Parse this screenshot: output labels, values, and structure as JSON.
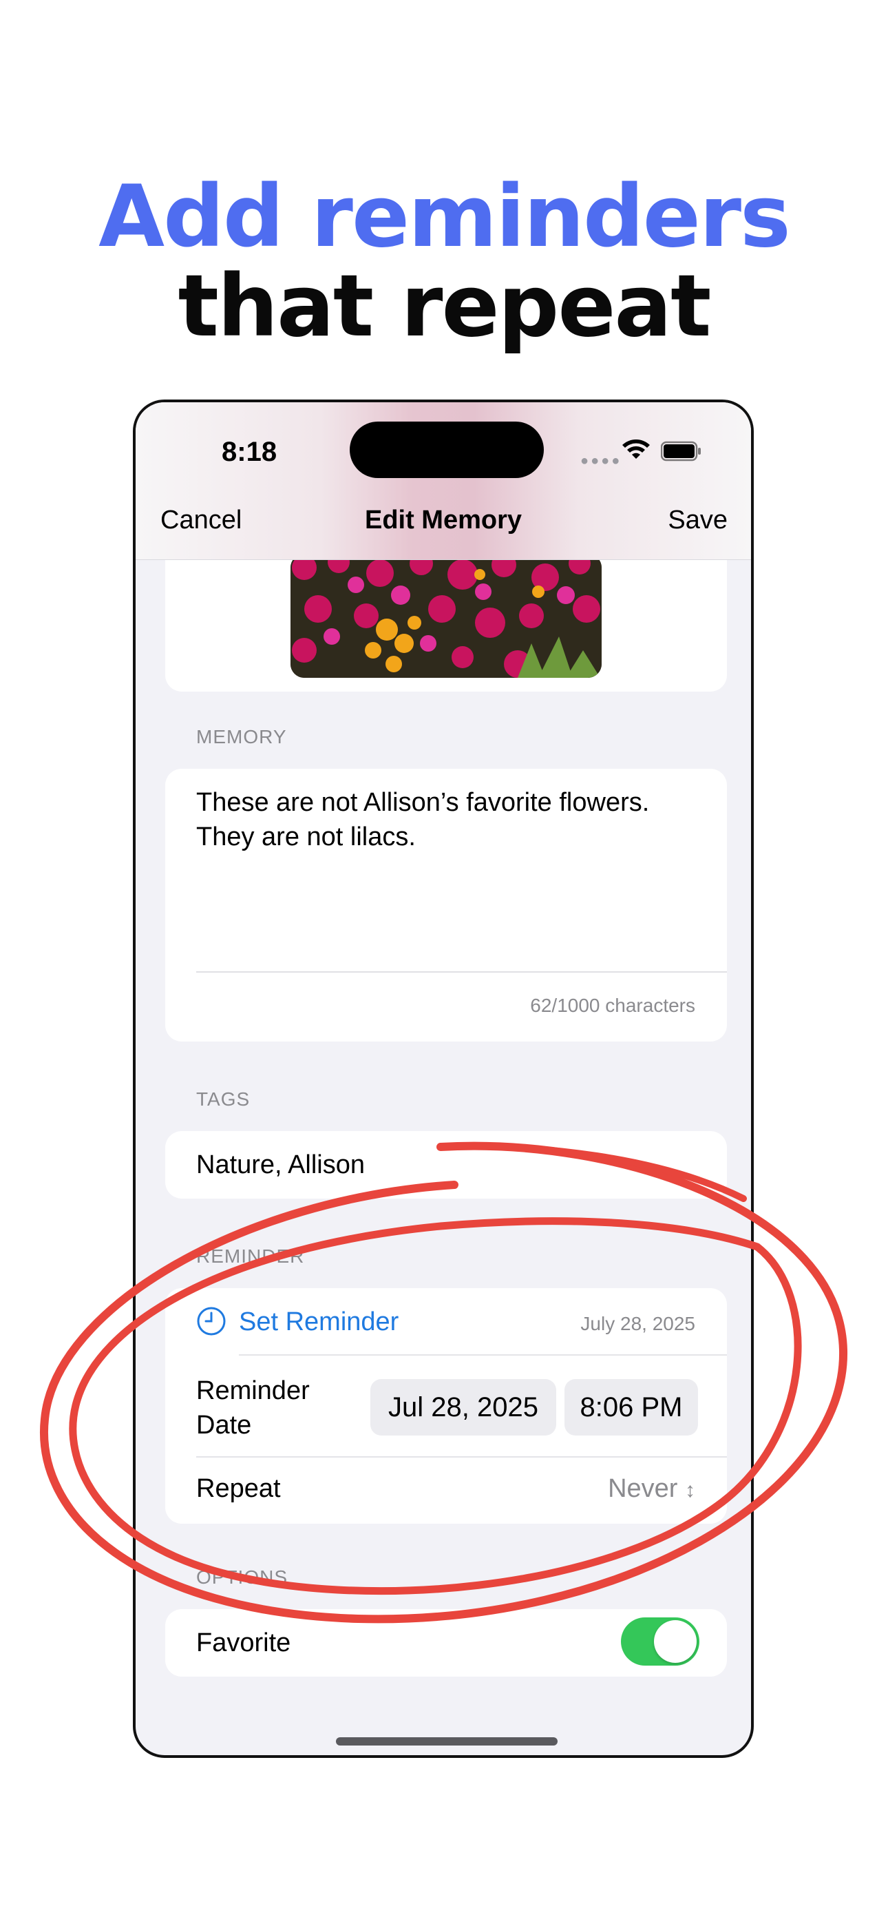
{
  "headline": {
    "line1": "Add reminders",
    "line2": "that repeat"
  },
  "status_bar": {
    "time": "8:18"
  },
  "nav": {
    "cancel": "Cancel",
    "title": "Edit Memory",
    "save": "Save"
  },
  "memory": {
    "label": "MEMORY",
    "text_line1": "These are not Allison’s favorite flowers.",
    "text_line2": "They are not lilacs.",
    "char_count": "62/1000 characters"
  },
  "tags": {
    "label": "TAGS",
    "value": "Nature, Allison"
  },
  "reminder": {
    "label": "REMINDER",
    "set_label": "Set Reminder",
    "date_summary": "July 28, 2025",
    "date_label_line1": "Reminder",
    "date_label_line2": "Date",
    "date_value": "Jul 28, 2025",
    "time_value": "8:06 PM",
    "repeat_label": "Repeat",
    "repeat_value": "Never"
  },
  "options": {
    "label": "OPTIONS",
    "favorite_label": "Favorite",
    "favorite_on": true
  },
  "colors": {
    "accent_blue": "#4f6df0",
    "link_blue": "#1f7ae0",
    "toggle_green": "#34c759",
    "annotation_red": "#e8453c"
  }
}
